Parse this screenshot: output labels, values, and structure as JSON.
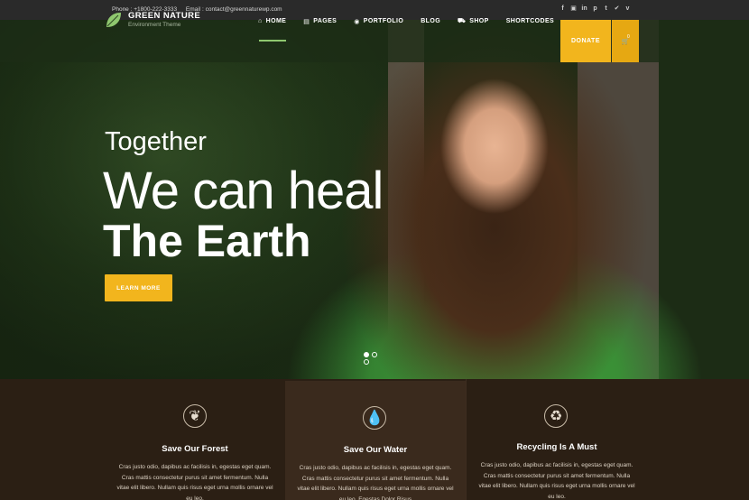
{
  "topbar": {
    "phone": "Phone : +1800-222-3333",
    "email": "Email : contact@greennaturewp.com",
    "social_icons": [
      "facebook-icon",
      "flickr-icon",
      "linkedin-icon",
      "pinterest-icon",
      "tumblr-icon",
      "twitter-icon",
      "vimeo-icon"
    ],
    "social_glyphs": [
      "f",
      "▣",
      "in",
      "p",
      "t",
      "✔",
      "v"
    ]
  },
  "brand": {
    "name": "GREEN NATURE",
    "tagline": "Environment Theme",
    "leaf_color": "#8fc86f"
  },
  "nav": {
    "items": [
      {
        "label": "HOME",
        "icon": "home-icon",
        "glyph": "⌂",
        "active": true
      },
      {
        "label": "PAGES",
        "icon": "document-icon",
        "glyph": "▤",
        "active": false
      },
      {
        "label": "PORTFOLIO",
        "icon": "globe-icon",
        "glyph": "◉",
        "active": false
      },
      {
        "label": "BLOG",
        "icon": "",
        "glyph": "",
        "active": false
      },
      {
        "label": "SHOP",
        "icon": "cart-icon",
        "glyph": "⛟",
        "active": false
      },
      {
        "label": "SHORTCODES",
        "icon": "",
        "glyph": "",
        "active": false
      }
    ],
    "donate_label": "DONATE",
    "cart_glyph": "🛒",
    "cart_count": "0"
  },
  "hero": {
    "line1": "Together",
    "line2": "We can heal",
    "line3": "The Earth",
    "cta_label": "LEARN MORE",
    "slide_count": 3,
    "active_slide": 1
  },
  "features": [
    {
      "icon": "leaf-icon",
      "glyph": "❦",
      "title": "Save Our Forest",
      "text": "Cras justo odio, dapibus ac facilisis in, egestas eget quam. Cras mattis consectetur purus sit amet fermentum. Nulla vitae elit libero. Nullam quis risus eget urna mollis ornare vel eu leo."
    },
    {
      "icon": "water-drop-icon",
      "glyph": "💧",
      "title": "Save Our Water",
      "text": "Cras justo odio, dapibus ac facilisis in, egestas eget quam. Cras mattis consectetur purus sit amet fermentum. Nulla vitae elit libero. Nullam quis risus eget urna mollis ornare vel eu leo. Egestas Dolor Risus"
    },
    {
      "icon": "recycle-icon",
      "glyph": "♻",
      "title": "Recycling Is A Must",
      "text": "Cras justo odio, dapibus ac facilisis in, egestas eget quam. Cras mattis consectetur purus sit amet fermentum. Nulla vitae elit libero. Nullam quis risus eget urna mollis ornare vel eu leo."
    }
  ],
  "colors": {
    "accent": "#f2b51d",
    "nav_active": "#8fc86f",
    "feature_bg": "#2b1f14",
    "feature_bg_highlight": "#3a2a1d"
  }
}
